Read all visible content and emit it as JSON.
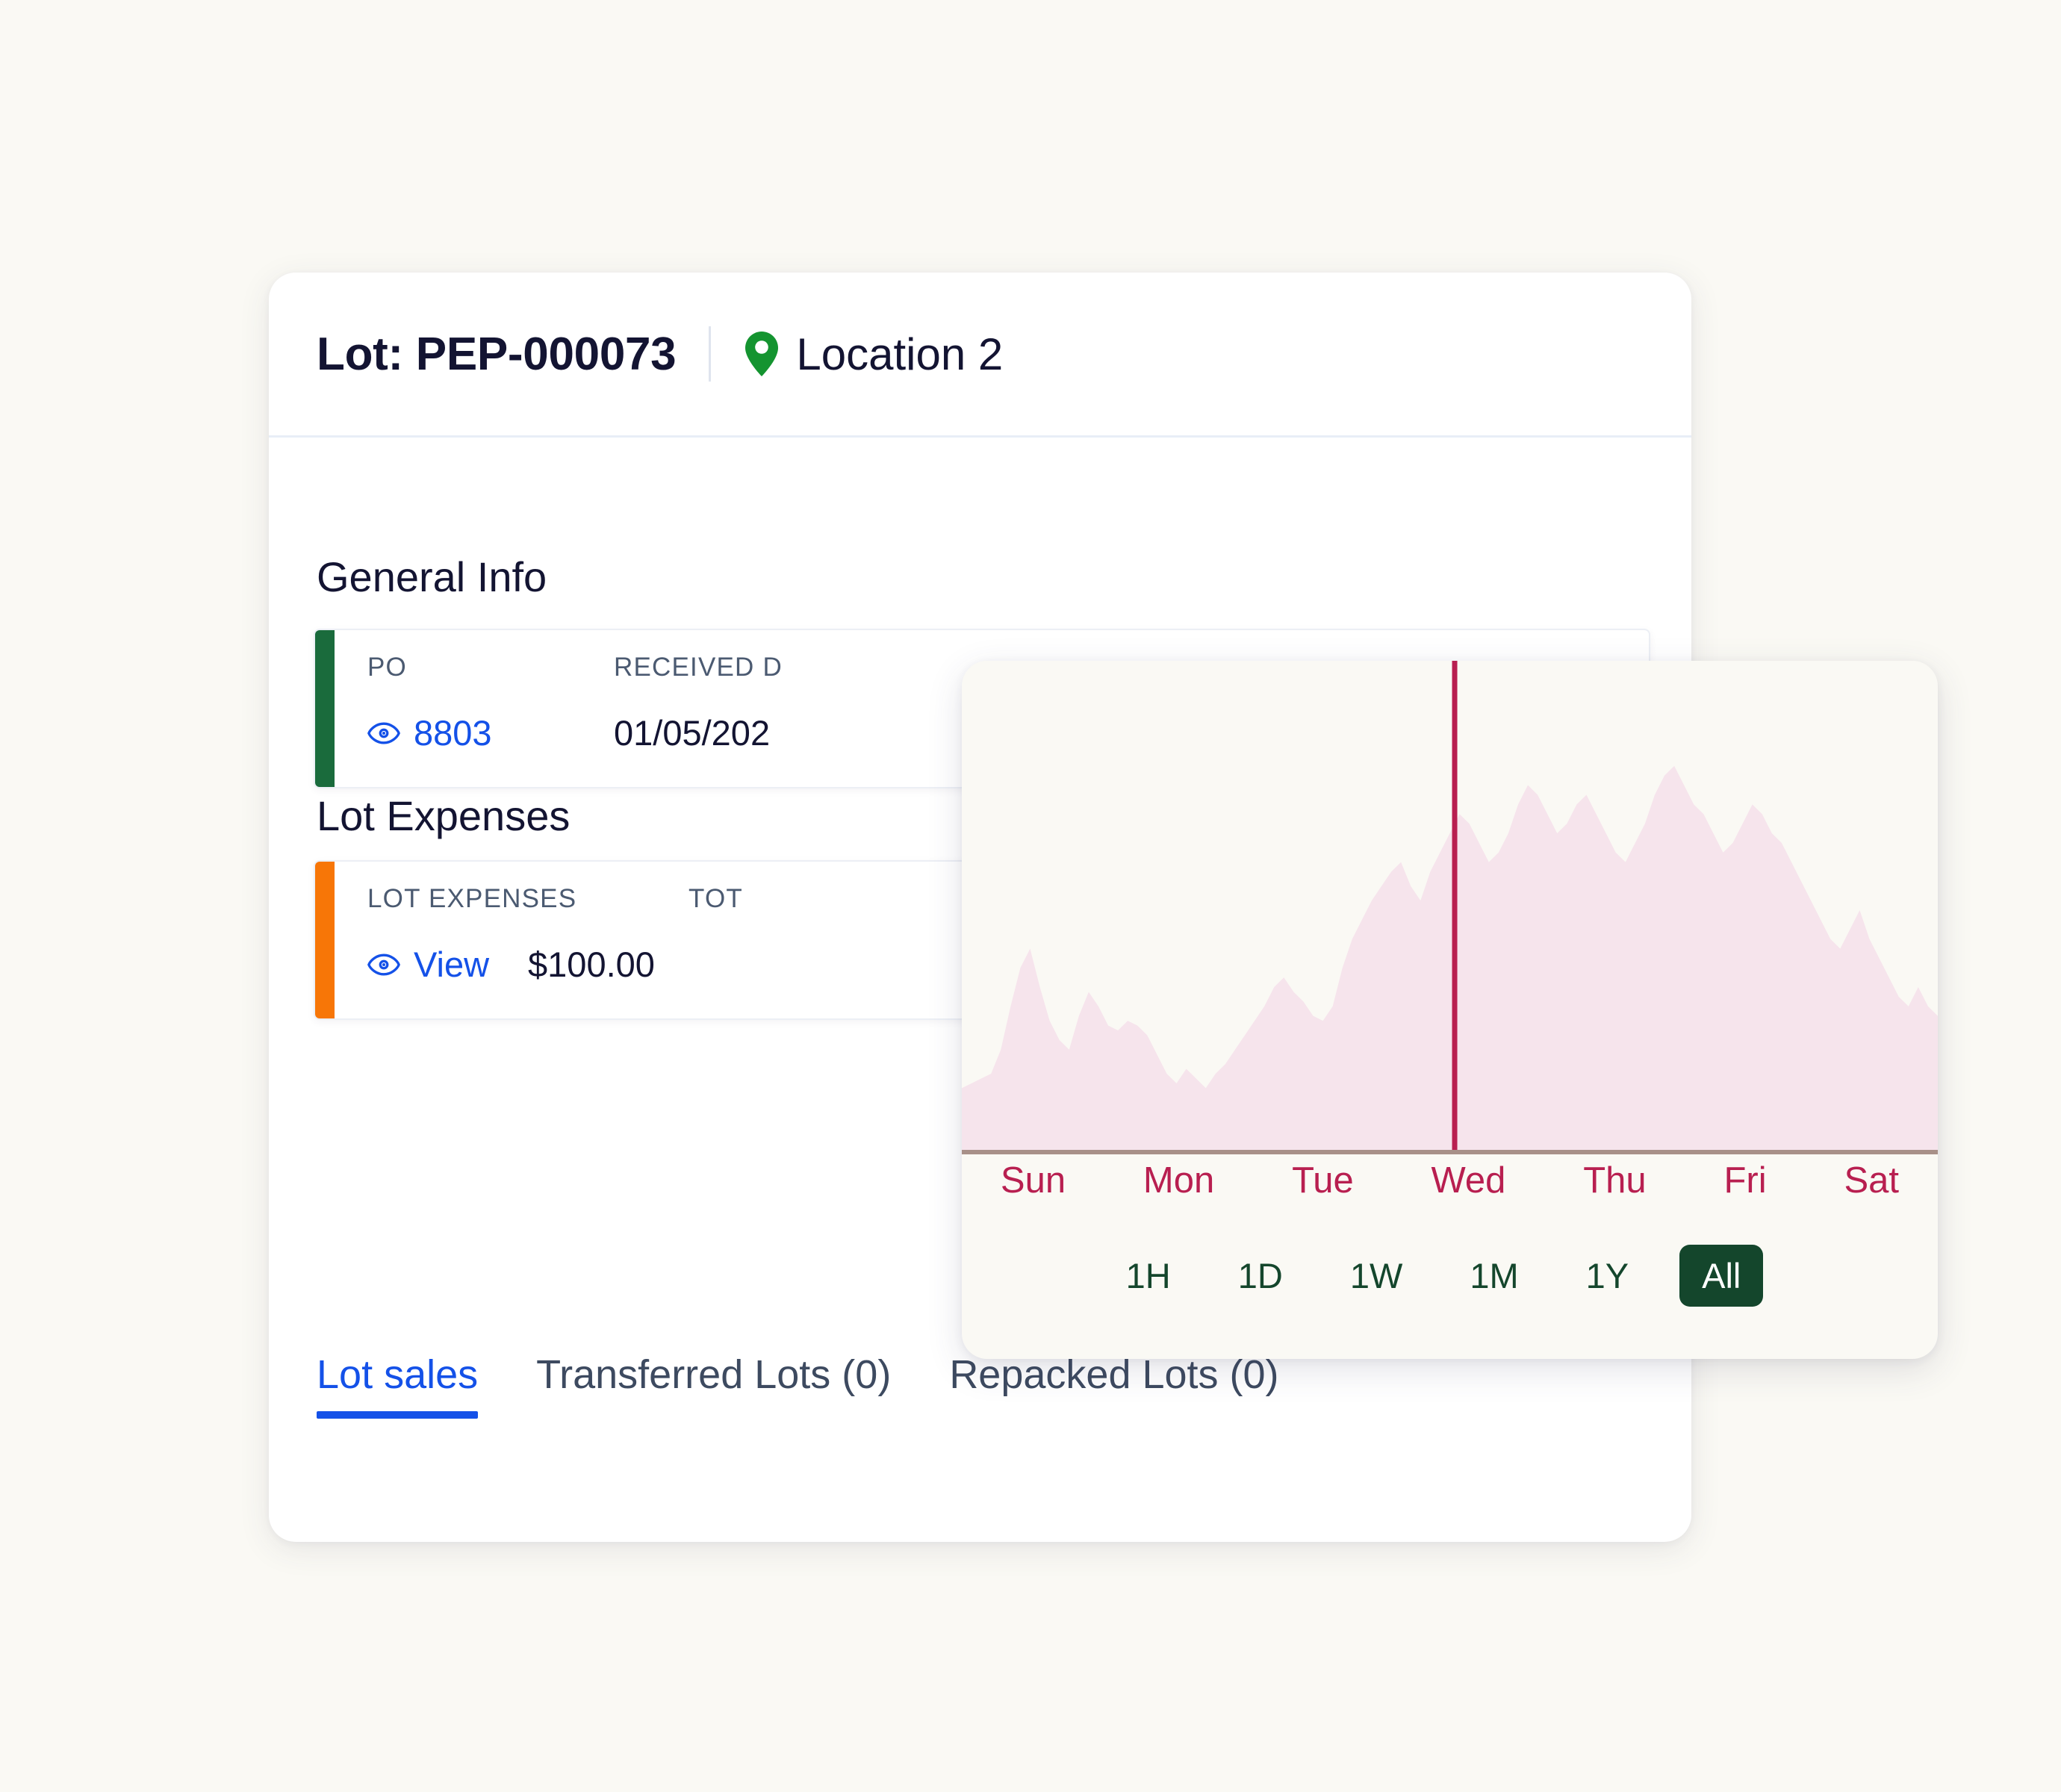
{
  "header": {
    "lot_title": "Lot: PEP-000073",
    "location_icon": "map-pin-icon",
    "location_label": "Location 2"
  },
  "sections": {
    "general_info_title": "General Info",
    "lot_expenses_title": "Lot Expenses"
  },
  "general_info": {
    "accent_color": "#1a6b3c",
    "po_label": "PO",
    "po_icon": "eye-icon",
    "po_value": "8803",
    "received_label": "RECEIVED D",
    "received_value": "01/05/202"
  },
  "lot_expenses": {
    "accent_color": "#f77607",
    "expenses_label": "LOT EXPENSES",
    "expenses_icon": "eye-icon",
    "expenses_link": "View",
    "expenses_amount": "$100.00",
    "total_label": "TOT"
  },
  "tabs": [
    {
      "label": "Lot sales",
      "active": true
    },
    {
      "label": "Transferred Lots (0)",
      "active": false
    },
    {
      "label": "Repacked Lots (0)",
      "active": false
    }
  ],
  "chart_panel": {
    "days": [
      "Sun",
      "Mon",
      "Tue",
      "Wed",
      "Thu",
      "Fri",
      "Sat"
    ],
    "ranges": [
      {
        "label": "1H",
        "active": false
      },
      {
        "label": "1D",
        "active": false
      },
      {
        "label": "1W",
        "active": false
      },
      {
        "label": "1M",
        "active": false
      },
      {
        "label": "1Y",
        "active": false
      },
      {
        "label": "All",
        "active": true
      }
    ]
  },
  "colors": {
    "page_background": "#faf9f4",
    "card_background": "#ffffff",
    "link_blue": "#1451e8",
    "heading_navy": "#131432",
    "label_slate": "#4b5a71",
    "accent_green": "#1a6b3c",
    "accent_orange": "#f77607",
    "pin_green": "#149430",
    "crimson": "#b81f50",
    "area_fill": "#f6e4ec",
    "axis_line": "#a89088",
    "tab_underline": "#1451e8"
  },
  "chart_data": {
    "type": "area",
    "title": "",
    "xlabel": "",
    "ylabel": "",
    "grid": false,
    "legend": "none",
    "xlim": [
      0,
      100
    ],
    "ylim": [
      0,
      100
    ],
    "tick_labels": [
      "Sun",
      "Mon",
      "Tue",
      "Wed",
      "Thu",
      "Fri",
      "Sat"
    ],
    "annotations": [
      {
        "type": "vline",
        "x": 50.5,
        "color": "#b81f50",
        "label": ""
      }
    ],
    "series": [
      {
        "name": "value",
        "fill_color": "#f6e4ec",
        "x": [
          0,
          1,
          2,
          3,
          4,
          5,
          6,
          7,
          8,
          9,
          10,
          11,
          12,
          13,
          14,
          15,
          16,
          17,
          18,
          19,
          20,
          21,
          22,
          23,
          24,
          25,
          26,
          27,
          28,
          29,
          30,
          31,
          32,
          33,
          34,
          35,
          36,
          37,
          38,
          39,
          40,
          41,
          42,
          43,
          44,
          45,
          46,
          47,
          48,
          49,
          50,
          51,
          52,
          53,
          54,
          55,
          56,
          57,
          58,
          59,
          60,
          61,
          62,
          63,
          64,
          65,
          66,
          67,
          68,
          69,
          70,
          71,
          72,
          73,
          74,
          75,
          76,
          77,
          78,
          79,
          80,
          81,
          82,
          83,
          84,
          85,
          86,
          87,
          88,
          89,
          90,
          91,
          92,
          93,
          94,
          95,
          96,
          97,
          98,
          99,
          100
        ],
        "values": [
          13,
          14,
          15,
          16,
          21,
          30,
          38,
          42,
          34,
          27,
          23,
          21,
          28,
          33,
          30,
          26,
          25,
          27,
          26,
          24,
          20,
          16,
          14,
          17,
          15,
          13,
          16,
          18,
          21,
          24,
          27,
          30,
          34,
          36,
          33,
          31,
          28,
          27,
          30,
          38,
          44,
          48,
          52,
          55,
          58,
          60,
          55,
          52,
          58,
          62,
          66,
          70,
          68,
          64,
          60,
          62,
          66,
          72,
          76,
          74,
          70,
          66,
          68,
          72,
          74,
          70,
          66,
          62,
          60,
          64,
          68,
          74,
          78,
          80,
          76,
          72,
          70,
          66,
          62,
          64,
          68,
          72,
          70,
          66,
          64,
          60,
          56,
          52,
          48,
          44,
          42,
          46,
          50,
          44,
          40,
          36,
          32,
          30,
          34,
          30,
          28
        ]
      }
    ]
  }
}
